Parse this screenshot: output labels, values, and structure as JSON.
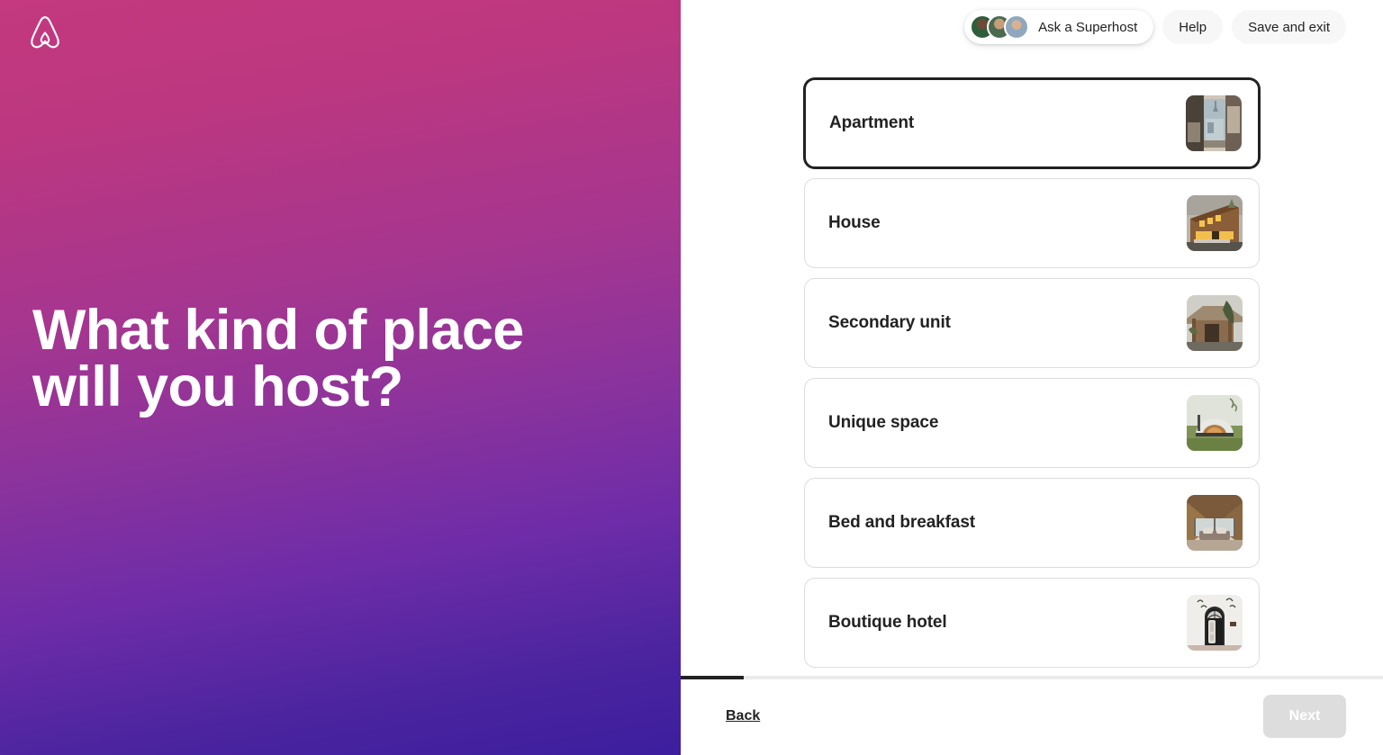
{
  "hero": {
    "logo_icon": "airbnb-belo-logo",
    "title": "What kind of place will you host?",
    "gradient_from": "#C4397F",
    "gradient_to": "#3C1E9E"
  },
  "header": {
    "superhost": {
      "label": "Ask a Superhost",
      "avatar_count": 3
    },
    "help_label": "Help",
    "save_exit_label": "Save and exit"
  },
  "main": {
    "options": [
      {
        "label": "Apartment",
        "selected": true,
        "thumb": "apartment-balcony-thumbnail"
      },
      {
        "label": "House",
        "selected": false,
        "thumb": "house-barn-thumbnail"
      },
      {
        "label": "Secondary unit",
        "selected": false,
        "thumb": "secondary-unit-casita-thumbnail"
      },
      {
        "label": "Unique space",
        "selected": false,
        "thumb": "unique-space-dome-thumbnail"
      },
      {
        "label": "Bed and breakfast",
        "selected": false,
        "thumb": "bed-and-breakfast-aframe-thumbnail"
      },
      {
        "label": "Boutique hotel",
        "selected": false,
        "thumb": "boutique-hotel-door-thumbnail"
      }
    ]
  },
  "footer": {
    "back_label": "Back",
    "next_label": "Next",
    "next_disabled": true,
    "progress_percent": 9
  }
}
